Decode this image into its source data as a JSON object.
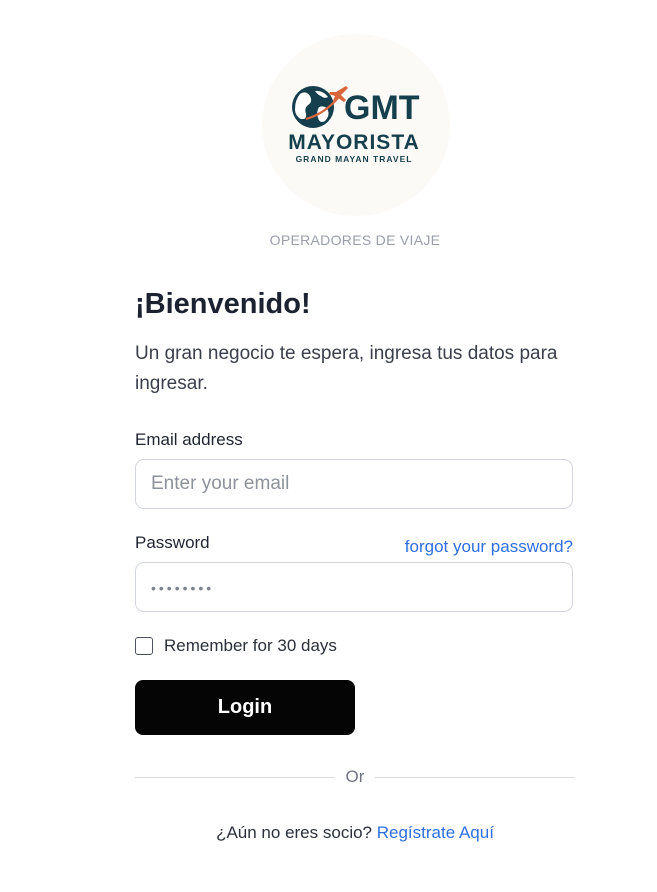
{
  "brand": {
    "logo_title": "GMT",
    "logo_name": "MAYORISTA",
    "logo_subtitle": "GRAND MAYAN TRAVEL",
    "colors": {
      "primary": "#163f4e",
      "accent": "#d8663a"
    }
  },
  "section_label": "OPERADORES DE VIAJE",
  "heading": "¡Bienvenido!",
  "subtitle": "Un gran negocio te espera, ingresa tus datos para ingresar.",
  "form": {
    "email": {
      "label": "Email address",
      "placeholder": "Enter your email",
      "value": ""
    },
    "password": {
      "label": "Password",
      "masked_value": "••••••••",
      "forgot_link": "forgot your password?"
    },
    "remember": {
      "label": "Remember for 30 days",
      "checked": false
    },
    "submit_label": "Login"
  },
  "divider": {
    "label": "Or"
  },
  "signup": {
    "prompt": "¿Aún no eres socio?",
    "link": "Regístrate Aquí"
  },
  "colors": {
    "link": "#2f6fe0",
    "button": "#050505"
  }
}
